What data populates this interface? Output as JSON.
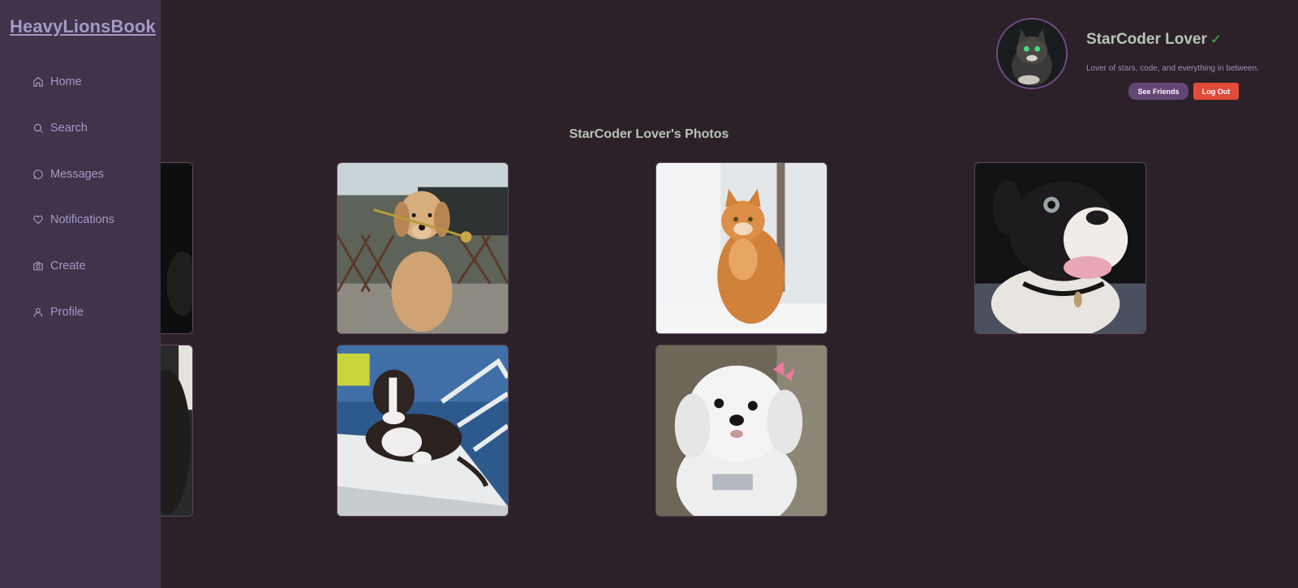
{
  "app": {
    "brand": "HeavyLionsBook"
  },
  "sidebar": {
    "items": [
      {
        "label": "Home",
        "icon": "home-icon"
      },
      {
        "label": "Search",
        "icon": "search-icon"
      },
      {
        "label": "Messages",
        "icon": "message-icon"
      },
      {
        "label": "Notifications",
        "icon": "heart-icon"
      },
      {
        "label": "Create",
        "icon": "camera-icon"
      },
      {
        "label": "Profile",
        "icon": "user-icon"
      }
    ]
  },
  "profile": {
    "name": "StarCoder Lover",
    "verified_mark": "✓",
    "bio": "Lover of stars, code, and everything in between.",
    "see_friends_label": "See Friends",
    "logout_label": "Log Out"
  },
  "photos": {
    "title": "StarCoder Lover's Photos",
    "items": [
      {
        "subject": "black dog (partially hidden)"
      },
      {
        "subject": "golden retriever puppy with rose"
      },
      {
        "subject": "orange tabby cat"
      },
      {
        "subject": "black and white french bulldog"
      },
      {
        "subject": "dark dog (partially hidden)"
      },
      {
        "subject": "pit bull puppy on lounge chair"
      },
      {
        "subject": "white maltese dog"
      }
    ]
  },
  "colors": {
    "background": "#2d2129",
    "sidebar": "#40334a",
    "accent_text": "#a39ac4",
    "verified": "#3bb54a",
    "see_friends": "#634676",
    "logout": "#e04b3a"
  }
}
